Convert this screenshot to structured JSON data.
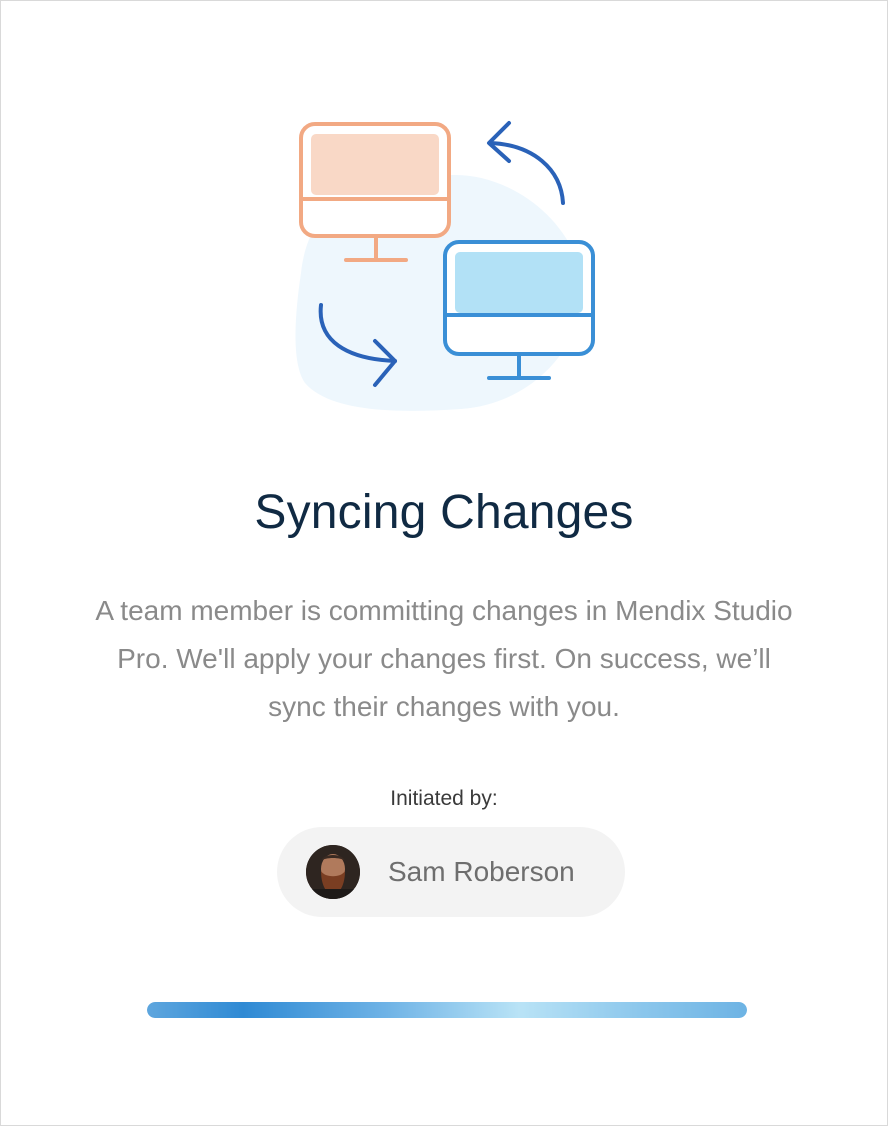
{
  "dialog": {
    "title": "Syncing Changes",
    "description": "A team member is committing changes in Mendix Studio Pro. We'll apply your changes first. On success, we’ll sync their changes with you.",
    "initiated_label": "Initiated by:",
    "user": {
      "name": "Sam Roberson",
      "avatar": "user-avatar-photo"
    },
    "progress": {
      "value": 1.0
    },
    "illustration": {
      "icons": [
        "monitor-orange-icon",
        "monitor-blue-icon",
        "arrow-curved-up-icon",
        "arrow-curved-down-icon"
      ]
    },
    "colors": {
      "title": "#102a43",
      "text": "#8a8a8a",
      "orange": "#f2a983",
      "blue": "#3a8fd6",
      "arrow": "#2a62b8",
      "blob": "#eef7fd"
    }
  }
}
